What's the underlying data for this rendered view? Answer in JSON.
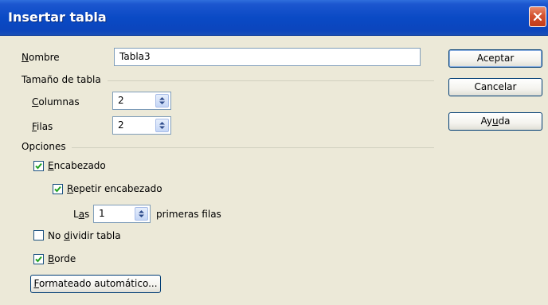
{
  "window": {
    "title": "Insertar tabla"
  },
  "name_field": {
    "label_pre": "",
    "label_mnemonic": "N",
    "label_post": "ombre",
    "value": "Tabla3"
  },
  "table_size": {
    "group_label": "Tamaño de tabla",
    "columns": {
      "label_mnemonic": "C",
      "label_post": "olumnas",
      "value": "2"
    },
    "rows": {
      "label_mnemonic": "F",
      "label_post": "ilas",
      "value": "2"
    }
  },
  "options": {
    "group_label": "Opciones",
    "heading": {
      "label_mnemonic": "E",
      "label_post": "ncabezado",
      "checked": true
    },
    "repeat_heading": {
      "label_mnemonic": "R",
      "label_post": "epetir encabezado",
      "checked": true
    },
    "first_rows": {
      "label_pre": "L",
      "label_mnemonic": "a",
      "label_post": "s",
      "value": "1",
      "suffix": "primeras filas"
    },
    "no_split": {
      "label_pre": "No ",
      "label_mnemonic": "d",
      "label_post": "ividir tabla",
      "checked": false
    },
    "border": {
      "label_mnemonic": "B",
      "label_post": "orde",
      "checked": true
    },
    "autoformat": {
      "label_mnemonic": "F",
      "label_post": "ormateado automático..."
    }
  },
  "buttons": {
    "ok": "Aceptar",
    "cancel": "Cancelar",
    "help_pre": "Ay",
    "help_mnemonic": "u",
    "help_post": "da"
  },
  "icons": [
    "close-icon",
    "spin-arrows-icon",
    "checkmark-icon"
  ]
}
